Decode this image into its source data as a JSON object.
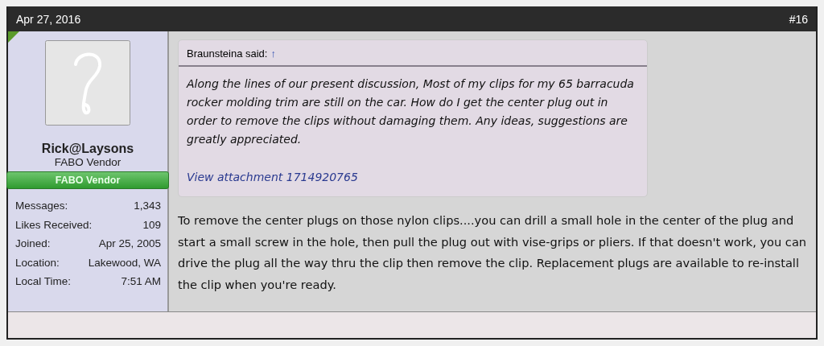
{
  "post": {
    "date": "Apr 27, 2016",
    "number": "#16"
  },
  "author": {
    "name": "Rick@Laysons",
    "title": "FABO Vendor",
    "banner": "FABO Vendor",
    "stats": [
      {
        "label": "Messages:",
        "value": "1,343"
      },
      {
        "label": "Likes Received:",
        "value": "109"
      },
      {
        "label": "Joined:",
        "value": "Apr 25, 2005"
      },
      {
        "label": "Location:",
        "value": "Lakewood, WA"
      },
      {
        "label": "Local Time:",
        "value": "7:51 AM"
      }
    ]
  },
  "quote": {
    "attribution": "Braunsteina said:",
    "jump": "↑",
    "text": "Along the lines of our present discussion, Most of my clips for my 65 barracuda rocker molding trim are still on the car. How do I get the center plug out in order to remove the clips without damaging them. Any ideas, suggestions are greatly appreciated.",
    "attachment": "View attachment 1714920765"
  },
  "body": "To remove the center plugs on those nylon clips....you can drill a small hole in the center of the plug and start a small screw in the hole, then pull the plug out with vise-grips or pliers. If that doesn't work, you can drive the plug all the way thru the clip then remove the clip. Replacement plugs are available to re-install the clip when you're ready."
}
